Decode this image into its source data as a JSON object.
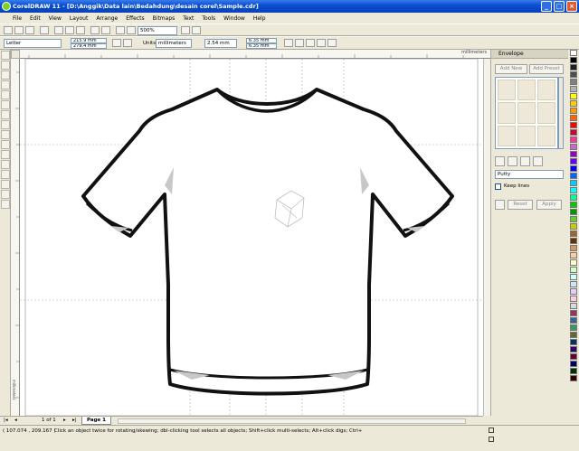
{
  "window": {
    "title": "CorelDRAW 11 - [D:\\Anggik\\Data lain\\Bedahdung\\desain corel\\Sample.cdr]",
    "controls": [
      "_",
      "□",
      "×"
    ]
  },
  "menu": [
    "File",
    "Edit",
    "View",
    "Layout",
    "Arrange",
    "Effects",
    "Bitmaps",
    "Text",
    "Tools",
    "Window",
    "Help"
  ],
  "toolbar": {
    "zoom_value": "500%"
  },
  "property_bar": {
    "paper_size": "Letter",
    "width": "215.9 mm",
    "height": "279.4 mm",
    "units_label": "Units:",
    "units_value": "millimeters",
    "nudge": "2.54 mm",
    "duplicate_x": "6.35 mm",
    "duplicate_y": "6.35 mm"
  },
  "rulers": {
    "top_unit": "millimeters",
    "left_unit": "millimeters"
  },
  "docker": {
    "title": "Envelope",
    "add_new_label": "Add New",
    "add_preset_label": "Add Preset",
    "mapping_mode": "Putty",
    "keep_lines_label": "Keep lines",
    "reset_label": "Reset",
    "apply_label": "Apply"
  },
  "page_nav": {
    "page_count": "1 of 1",
    "tab_label": "Page 1"
  },
  "status": {
    "coords": "( 107.074 , 209.167 )",
    "hint": "Click an object twice for rotating/skewing; dbl-clicking tool selects all objects; Shift+click multi-selects; Alt+click digs; Ctrl+click selects in a group"
  },
  "palette": [
    "#ffffff",
    "#000000",
    "#1f1f1f",
    "#4d4d4d",
    "#808080",
    "#b3b3b3",
    "#ffff00",
    "#ffcc00",
    "#ff9900",
    "#ff6600",
    "#ff0000",
    "#cc0033",
    "#ff3399",
    "#cc66cc",
    "#9900cc",
    "#6600ff",
    "#0000ff",
    "#0066ff",
    "#00ccff",
    "#00ffff",
    "#00ff99",
    "#00cc00",
    "#009900",
    "#66cc33",
    "#cccc00",
    "#996633",
    "#663300",
    "#cc9966",
    "#ffcc99",
    "#ffffcc",
    "#ccffcc",
    "#ccffff",
    "#cce5ff",
    "#e5ccff",
    "#ffcce5",
    "#d9d9d9",
    "#993366",
    "#336699",
    "#339966",
    "#666633",
    "#003366",
    "#330066",
    "#660033",
    "#000066",
    "#003300",
    "#330000"
  ]
}
